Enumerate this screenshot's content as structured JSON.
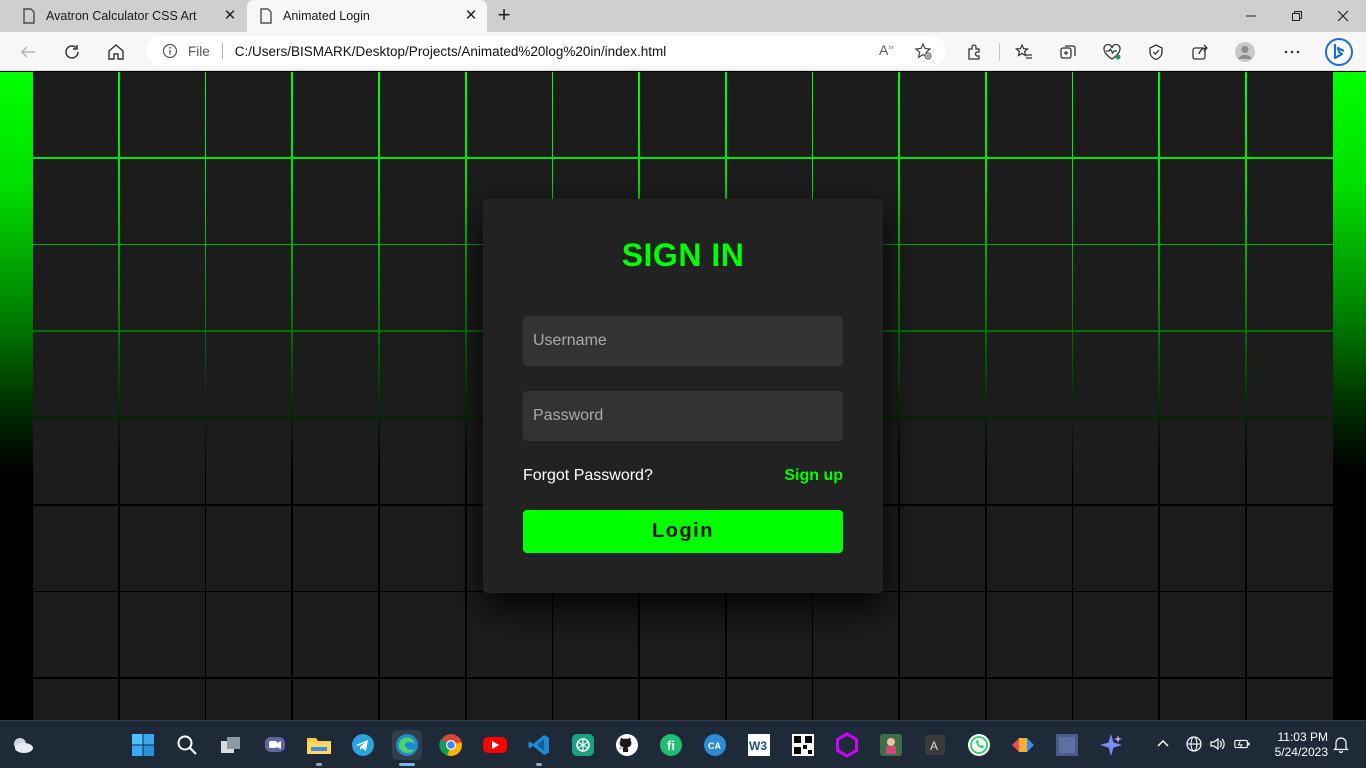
{
  "browser": {
    "tabs": [
      {
        "title": "Avatron Calculator CSS Art",
        "active": false
      },
      {
        "title": "Animated Login",
        "active": true
      }
    ],
    "address": {
      "scheme_label": "File",
      "url": "C:/Users/BISMARK/Desktop/Projects/Animated%20log%20in/index.html"
    }
  },
  "page": {
    "title": "SIGN IN",
    "username_placeholder": "Username",
    "password_placeholder": "Password",
    "forgot_label": "Forgot Password?",
    "signup_label": "Sign up",
    "login_label": "Login",
    "accent_color": "#00ff00"
  },
  "taskbar": {
    "pinned": [
      "windows-start",
      "search",
      "task-view",
      "teams-chat",
      "file-explorer",
      "telegram",
      "edge",
      "chrome",
      "youtube",
      "vscode",
      "chatgpt",
      "github",
      "fiverr",
      "canva",
      "w3schools",
      "qr-app",
      "figma-like",
      "game-app",
      "app-a",
      "whatsapp",
      "app-arrows",
      "app-square",
      "copilot"
    ],
    "clock": {
      "time": "11:03 PM",
      "date": "5/24/2023"
    }
  }
}
